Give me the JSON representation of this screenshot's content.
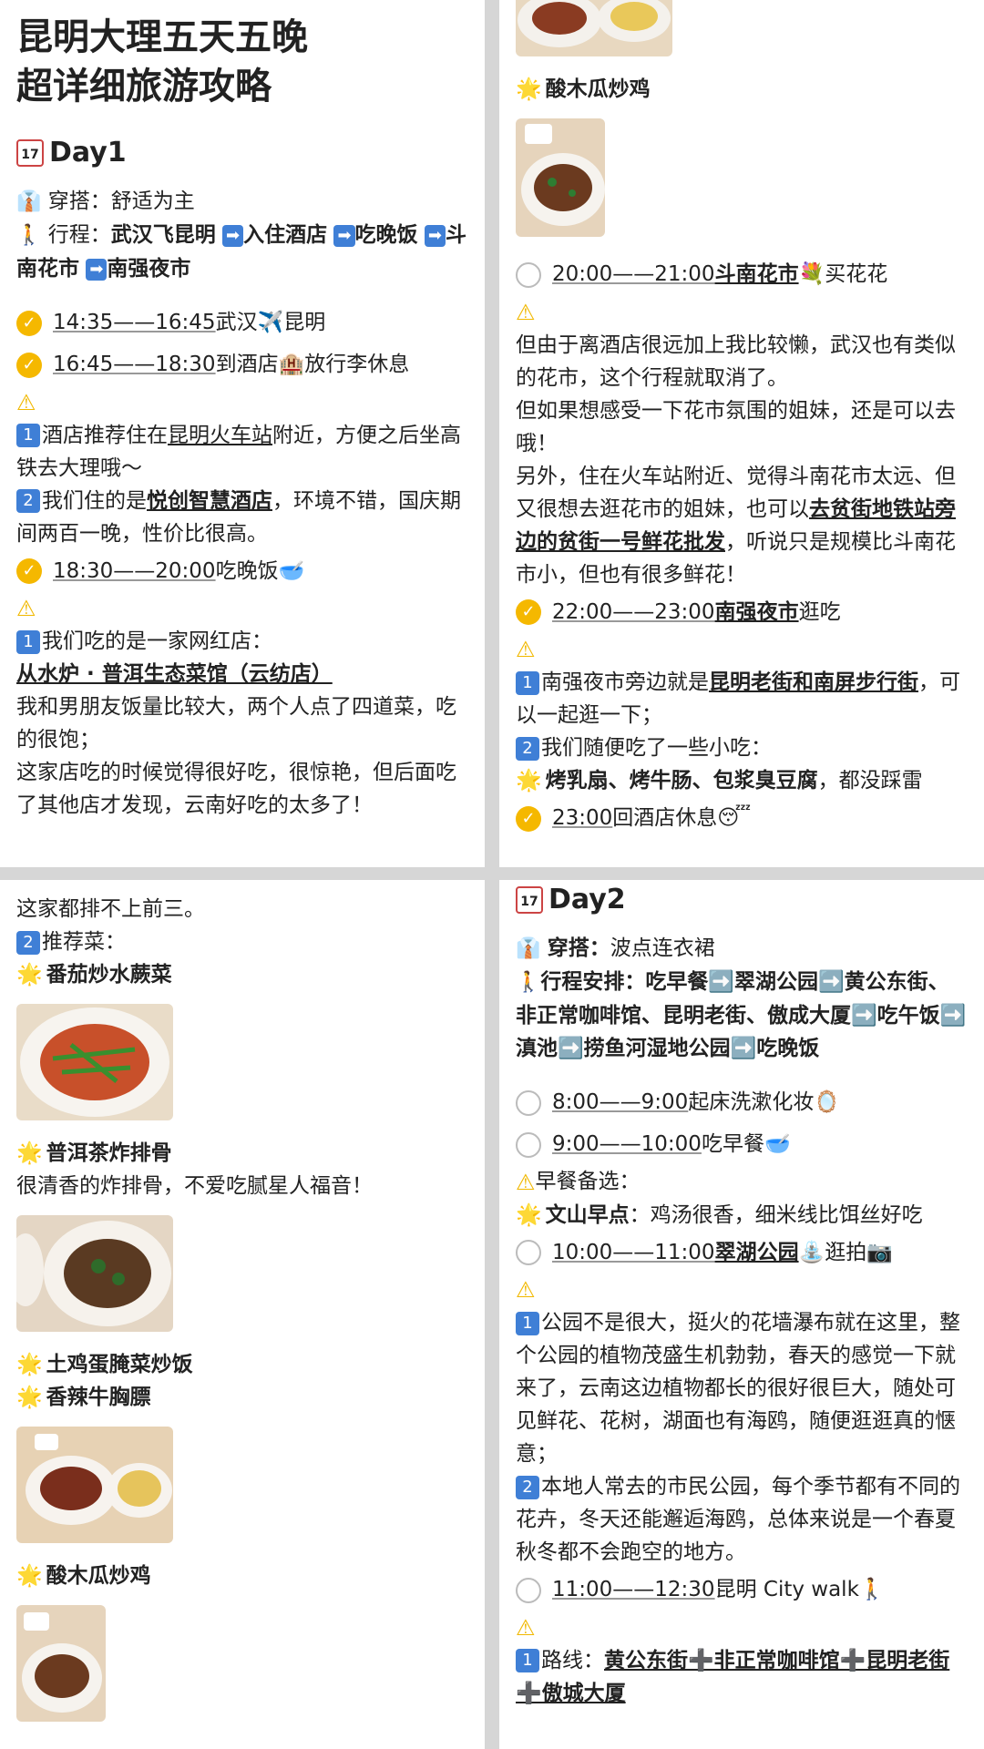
{
  "panel1": {
    "title_line1": "昆明大理五天五晚",
    "title_line2": "超详细旅游攻略",
    "day_label": "Day1",
    "cal_glyph": "17",
    "outfit_label": "穿搭：",
    "outfit_value": "舒适为主",
    "route_label": "行程：",
    "route_parts": [
      "武汉飞昆明",
      "入住酒店",
      "吃晚饭",
      "斗南花市",
      "南强夜市"
    ],
    "s1_time": "14:35——16:45",
    "s1_text": "武汉✈️昆明",
    "s2_time": "16:45——18:30",
    "s2_text": "到酒店🏨放行李休息",
    "n1_a": "酒店推荐住在",
    "n1_b": "昆明火车站",
    "n1_c": "附近，方便之后坐高铁去大理哦～",
    "n2_a": "我们住的是",
    "n2_b": "悦创智慧酒店",
    "n2_c": "，环境不错，国庆期间两百一晚，性价比很高。",
    "s3_time": "18:30——20:00",
    "s3_text": "吃晚饭🥣",
    "n3_a": "我们吃的是一家网红店：",
    "n3_b": "从水炉 · 普洱生态菜馆（云纺店）",
    "p_a": "我和男朋友饭量比较大，两个人点了四道菜，吃的很饱；",
    "p_b": "这家店吃的时候觉得很好吃，很惊艳，但后面吃了其他店才发现，云南好吃的太多了！"
  },
  "panel2": {
    "dish": "酸木瓜炒鸡",
    "s1_time": "20:00——21:00",
    "s1_place": "斗南花市",
    "s1_text": "💐买花花",
    "para1": "但由于离酒店很远加上我比较懒，武汉也有类似的花市，这个行程就取消了。",
    "para2": "但如果想感受一下花市氛围的姐妹，还是可以去哦！",
    "para3_a": "另外，住在火车站附近、觉得斗南花市太远、但又很想去逛花市的姐妹，也可以",
    "para3_b": "去贫街地铁站旁边的贫街一号鲜花批发",
    "para3_c": "，听说只是规模比斗南花市小，但也有很多鲜花！",
    "s2_time": "22:00——23:00",
    "s2_place": "南强夜市",
    "s2_text": "逛吃",
    "n1_a": "南强夜市旁边就是",
    "n1_b": "昆明老街和南屏步行街",
    "n1_c": "，可以一起逛一下；",
    "n2": "我们随便吃了一些小吃：",
    "snacks_b": "烤乳扇、烤牛肠、包浆臭豆腐",
    "snacks_c": "，都没踩雷",
    "s3_time": "23:00",
    "s3_text": "回酒店休息😴"
  },
  "panel3": {
    "top_line": "这家都排不上前三。",
    "rec_label": "推荐菜：",
    "dish1": "番茄炒水蕨菜",
    "dish2": "普洱茶炸排骨",
    "dish2_note": "很清香的炸排骨，不爱吃腻星人福音！",
    "dish3": "土鸡蛋腌菜炒饭",
    "dish4": "香辣牛胸膘",
    "dish5": "酸木瓜炒鸡"
  },
  "panel4": {
    "day_label": "Day2",
    "cal_glyph": "17",
    "outfit_label": "穿搭：",
    "outfit_value": "波点连衣裙",
    "route_text": "行程安排：吃早餐➡️翠湖公园➡️黄公东街、非正常咖啡馆、昆明老街、傲成大厦➡️吃午饭➡️滇池➡️捞鱼河湿地公园➡️吃晚饭",
    "s1_time": "8:00——9:00",
    "s1_text": "起床洗漱化妆🪞",
    "s2_time": "9:00——10:00",
    "s2_text": "吃早餐🥣",
    "bf_label": "早餐备选：",
    "bf_name": "文山早点",
    "bf_text": "：鸡汤很香，细米线比饵丝好吃",
    "s3_time": "10:00——11:00",
    "s3_place": "翠湖公园",
    "s3_text": "⛲逛拍📷",
    "n1": "公园不是很大，挺火的花墙瀑布就在这里，整个公园的植物茂盛生机勃勃，春天的感觉一下就来了，云南这边植物都长的很好很巨大，随处可见鲜花、花树，湖面也有海鸥，随便逛逛真的惬意；",
    "n2": "本地人常去的市民公园，每个季节都有不同的花卉，冬天还能邂逅海鸥，总体来说是一个春夏秋冬都不会跑空的地方。",
    "s4_time": "11:00——12:30",
    "s4_text": "昆明 City walk🚶",
    "n3_a": "路线：",
    "n3_b": "黄公东街➕非正常咖啡馆➕昆明老街➕傲城大厦"
  },
  "glyphs": {
    "check": "✓",
    "warn": "⚠",
    "star": "🌟",
    "arrow": "➡",
    "one": "1",
    "two": "2",
    "shirt": "👔",
    "walk": "🚶"
  },
  "colors": {
    "accent_blue": "#3f7fd6",
    "check_yellow": "#f5b800",
    "divider": "#d6d6d6"
  }
}
